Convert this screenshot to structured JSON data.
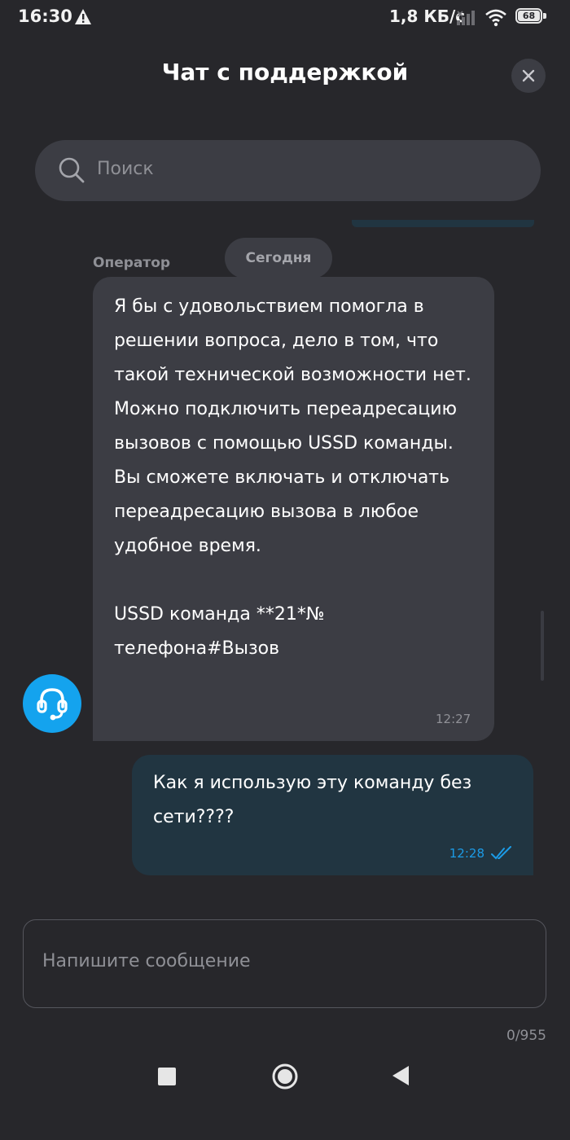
{
  "status_bar": {
    "time": "16:30",
    "network_speed": "1,8 КБ/с",
    "battery_level": "68",
    "icons": [
      "warning-icon",
      "signal-icon",
      "wifi-icon",
      "battery-icon"
    ]
  },
  "header": {
    "title": "Чат с поддержкой",
    "close_icon": "close-icon"
  },
  "search": {
    "placeholder": "Поиск",
    "icon": "search-icon"
  },
  "chat": {
    "date_separator": "Сегодня",
    "messages": [
      {
        "sender": "Оператор",
        "text": "Я бы с удовольствием помогла в решении вопроса, дело в том, что такой технической возможности нет. Можно подключить переадресацию вызовов с помощью USSD команды. Вы сможете включать и отключать переадресацию вызова в любое удобное время.\n\nUSSD команда **21*№ телефона#Вызов",
        "time": "12:27",
        "avatar_icon": "headset-icon"
      },
      {
        "sender": "user",
        "text": "Как я использую эту команду без сети????",
        "time": "12:28",
        "status_icon": "double-check-icon"
      }
    ]
  },
  "composer": {
    "placeholder": "Напишите сообщение",
    "counter": "0/955"
  },
  "colors": {
    "background": "#27272b",
    "operator_bubble": "#3c3d44",
    "user_bubble": "#213541",
    "accent": "#14a3ee",
    "read_status": "#1c9be6"
  },
  "nav_bar": {
    "icons": [
      "recent-apps-icon",
      "home-icon",
      "back-icon"
    ]
  }
}
